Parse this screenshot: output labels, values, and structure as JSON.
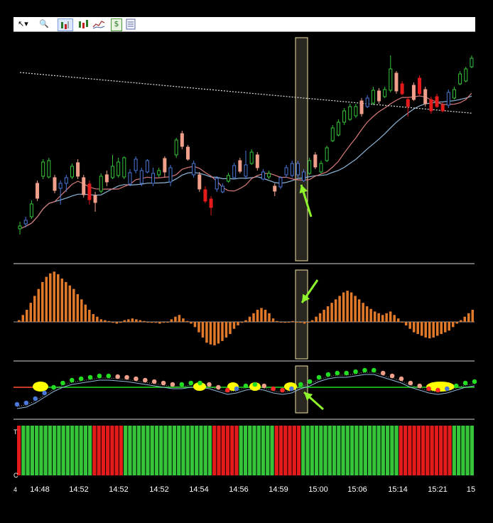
{
  "toolbar": {
    "tools": [
      {
        "name": "cursor-icon",
        "glyph": "↖▾"
      },
      {
        "name": "zoom-icon",
        "glyph": "🔍"
      },
      {
        "name": "bar-chart-icon",
        "glyph": "▮"
      },
      {
        "name": "candlestick-icon",
        "glyph": "▮"
      },
      {
        "name": "line-chart-icon",
        "glyph": "∿"
      },
      {
        "name": "dollar-icon",
        "glyph": "$"
      },
      {
        "name": "properties-icon",
        "glyph": "▤"
      }
    ]
  },
  "colors": {
    "background": "#000000",
    "separator": "#d8d8d8",
    "bull": "#35c43a",
    "bear": "#e51b1b",
    "bull_weak": "#4a78d8",
    "bear_weak": "#f0a08a",
    "histogram": "#e07a2a",
    "highlight_fill": "#2a2620",
    "highlight_edge": "#f2e4a6",
    "arrow": "#8ef32a",
    "ma_fast": "#d87a7a",
    "ma_slow": "#8fb6d8",
    "ma_200": "#e0e0e0",
    "zero_line": "#22e022",
    "signal_red": "#ff2a2a",
    "signal_yellow": "#ffff00",
    "text": "#ffffff"
  },
  "axis": {
    "time_labels": [
      "14:48",
      "14:52",
      "14:52",
      "14:52",
      "14:54",
      "14:56",
      "14:59",
      "15:00",
      "15:06",
      "15:14",
      "15:21",
      "15"
    ],
    "panel_labels": [
      "T",
      "C"
    ],
    "corner_label": "4"
  },
  "chart_data": [
    {
      "type": "candlestick",
      "series": [
        {
          "name": "price",
          "values": [
            [
              "bull",
              318,
              322,
              312,
              330
            ],
            [
              "bull_weak",
              310,
              315,
              305,
              320
            ],
            [
              "bull",
              287,
              305,
              282,
              308
            ],
            [
              "bear_weak",
              258,
              279,
              254,
              283
            ],
            [
              "bull",
              228,
              248,
              224,
              252
            ],
            [
              "bull",
              226,
              249,
              222,
              251
            ],
            [
              "bear_weak",
              250,
              268,
              246,
              272
            ],
            [
              "bull_weak",
              258,
              265,
              254,
              288
            ],
            [
              "bull_weak",
              250,
              258,
              246,
              270
            ],
            [
              "bull",
              234,
              249,
              230,
              252
            ],
            [
              "bear_weak",
              229,
              248,
              224,
              252
            ],
            [
              "bear_weak",
              250,
              274,
              246,
              278
            ],
            [
              "bear",
              259,
              281,
              254,
              288
            ],
            [
              "bear_weak",
              275,
              285,
              270,
              298
            ],
            [
              "bull",
              248,
              269,
              244,
              272
            ],
            [
              "bear_weak",
              246,
              256,
              240,
              262
            ],
            [
              "bull",
              234,
              250,
              218,
              252
            ],
            [
              "bull",
              228,
              247,
              222,
              250
            ],
            [
              "bull",
              222,
              249,
              220,
              252
            ],
            [
              "bull_weak",
              243,
              259,
              238,
              262
            ],
            [
              "bull_weak",
              224,
              240,
              220,
              244
            ],
            [
              "bull_weak",
              240,
              258,
              236,
              262
            ],
            [
              "bull_weak",
              226,
              242,
              224,
              244
            ],
            [
              "bull_weak",
              244,
              258,
              236,
              262
            ],
            [
              "bull",
              240,
              246,
              236,
              250
            ],
            [
              "bear_weak",
              223,
              242,
              220,
              250
            ],
            [
              "bull_weak",
              236,
              256,
              232,
              262
            ],
            [
              "bull",
              197,
              218,
              194,
              222
            ],
            [
              "bear_weak",
              188,
              206,
              184,
              210
            ],
            [
              "bear_weak",
              207,
              224,
              204,
              226
            ],
            [
              "bull_weak",
              230,
              246,
              226,
              250
            ],
            [
              "bear_weak",
              246,
              266,
              242,
              270
            ],
            [
              "bear",
              267,
              283,
              262,
              286
            ],
            [
              "bear",
              280,
              292,
              276,
              303
            ],
            [
              "bull_weak",
              251,
              266,
              248,
              270
            ],
            [
              "bull_weak",
              262,
              270,
              258,
              272
            ],
            [
              "bull",
              247,
              255,
              243,
              257
            ],
            [
              "bull_weak",
              233,
              250,
              229,
              252
            ],
            [
              "bear_weak",
              226,
              241,
              222,
              244
            ],
            [
              "bull_weak",
              232,
              248,
              212,
              252
            ],
            [
              "bull",
              214,
              230,
              210,
              232
            ],
            [
              "bear_weak",
              218,
              236,
              214,
              240
            ],
            [
              "bull_weak",
              242,
              252,
              238,
              254
            ],
            [
              "bull",
              244,
              249,
              240,
              252
            ],
            [
              "bear_weak",
              262,
              269,
              258,
              276
            ],
            [
              "bull_weak",
              250,
              263,
              248,
              266
            ],
            [
              "bull_weak",
              236,
              246,
              232,
              250
            ],
            [
              "bull_weak",
              230,
              247,
              226,
              250
            ],
            [
              "bull_weak",
              230,
              246,
              226,
              250
            ],
            [
              "bull_weak",
              242,
              254,
              238,
              256
            ],
            [
              "bull",
              226,
              244,
              222,
              246
            ],
            [
              "bear_weak",
              218,
              235,
              214,
              238
            ],
            [
              "bull",
              230,
              242,
              226,
              244
            ],
            [
              "bull",
              208,
              226,
              205,
              228
            ],
            [
              "bull",
              180,
              198,
              176,
              200
            ],
            [
              "bull",
              172,
              190,
              168,
              192
            ],
            [
              "bull",
              156,
              172,
              152,
              176
            ],
            [
              "bull",
              150,
              168,
              146,
              170
            ],
            [
              "bull",
              150,
              163,
              146,
              166
            ],
            [
              "bear_weak",
              142,
              160,
              138,
              164
            ],
            [
              "bull_weak",
              138,
              150,
              134,
              152
            ],
            [
              "bull",
              127,
              145,
              122,
              148
            ],
            [
              "bear_weak",
              128,
              142,
              124,
              146
            ],
            [
              "bull",
              126,
              136,
              122,
              138
            ],
            [
              "bull",
              97,
              127,
              78,
              130
            ],
            [
              "bear_weak",
              103,
              128,
              100,
              132
            ],
            [
              "bear",
              118,
              132,
              114,
              134
            ],
            [
              "bear",
              140,
              150,
              136,
              164
            ],
            [
              "bear_weak",
              120,
              140,
              116,
              142
            ],
            [
              "bear",
              110,
              132,
              106,
              134
            ],
            [
              "bear_weak",
              126,
              146,
              122,
              150
            ],
            [
              "bear",
              140,
              156,
              136,
              160
            ],
            [
              "bear",
              136,
              150,
              132,
              152
            ],
            [
              "bear",
              148,
              156,
              144,
              158
            ],
            [
              "bull_weak",
              130,
              148,
              126,
              152
            ],
            [
              "bull",
              126,
              138,
              122,
              140
            ],
            [
              "bull",
              104,
              118,
              100,
              120
            ],
            [
              "bull",
              97,
              114,
              94,
              116
            ],
            [
              "bull",
              82,
              94,
              78,
              96
            ]
          ]
        }
      ],
      "highlight_bar_index": 51
    },
    {
      "type": "bar",
      "values": [
        2,
        8,
        14,
        22,
        30,
        38,
        46,
        52,
        56,
        58,
        55,
        50,
        46,
        42,
        38,
        32,
        26,
        20,
        14,
        9,
        6,
        3,
        2,
        1,
        -1,
        -2,
        -1,
        2,
        3,
        4,
        3,
        2,
        1,
        0,
        -1,
        -1,
        -2,
        -1,
        0,
        3,
        6,
        8,
        4,
        1,
        -2,
        -6,
        -12,
        -18,
        -24,
        -26,
        -27,
        -25,
        -22,
        -18,
        -14,
        -8,
        -4,
        -1,
        2,
        6,
        10,
        14,
        16,
        14,
        10,
        4,
        1,
        0,
        -1,
        0,
        1,
        0,
        -1,
        -2,
        0,
        2,
        6,
        10,
        14,
        18,
        22,
        26,
        30,
        34,
        36,
        34,
        30,
        26,
        22,
        18,
        15,
        12,
        10,
        8,
        10,
        12,
        8,
        4,
        0,
        -4,
        -8,
        -12,
        -14,
        -16,
        -18,
        -19,
        -18,
        -16,
        -14,
        -12,
        -10,
        -6,
        -2,
        2,
        6,
        10,
        14
      ],
      "highlight_bar_index": 62
    },
    {
      "type": "scatter",
      "series": [
        {
          "values": [
            [
              0.0,
              -24
            ],
            [
              0.02,
              -22
            ],
            [
              0.04,
              -16
            ],
            [
              0.06,
              -8
            ],
            [
              0.08,
              0
            ],
            [
              0.1,
              6
            ],
            [
              0.12,
              10
            ],
            [
              0.14,
              12
            ],
            [
              0.16,
              14
            ],
            [
              0.18,
              16
            ],
            [
              0.2,
              16
            ],
            [
              0.22,
              15
            ],
            [
              0.24,
              14
            ],
            [
              0.26,
              12
            ],
            [
              0.28,
              10
            ],
            [
              0.3,
              8
            ],
            [
              0.32,
              6
            ],
            [
              0.34,
              4
            ],
            [
              0.36,
              4
            ],
            [
              0.38,
              6
            ],
            [
              0.4,
              6
            ],
            [
              0.42,
              4
            ],
            [
              0.44,
              0
            ],
            [
              0.46,
              -4
            ],
            [
              0.48,
              -2
            ],
            [
              0.5,
              2
            ],
            [
              0.52,
              4
            ],
            [
              0.54,
              2
            ],
            [
              0.56,
              -2
            ],
            [
              0.58,
              -4
            ],
            [
              0.6,
              -2
            ],
            [
              0.62,
              4
            ],
            [
              0.64,
              8
            ],
            [
              0.66,
              14
            ],
            [
              0.68,
              18
            ],
            [
              0.7,
              20
            ],
            [
              0.72,
              20
            ],
            [
              0.74,
              22
            ],
            [
              0.76,
              24
            ],
            [
              0.78,
              24
            ],
            [
              0.8,
              20
            ],
            [
              0.82,
              16
            ],
            [
              0.84,
              12
            ],
            [
              0.86,
              6
            ],
            [
              0.88,
              2
            ],
            [
              0.9,
              -2
            ],
            [
              0.92,
              -4
            ],
            [
              0.94,
              -2
            ],
            [
              0.96,
              2
            ],
            [
              0.98,
              6
            ],
            [
              1.0,
              8
            ]
          ]
        }
      ]
    },
    {
      "type": "bar",
      "values": [
        "red",
        "green",
        "green",
        "green",
        "green",
        "green",
        "green",
        "green",
        "green",
        "green",
        "green",
        "green",
        "green",
        "green",
        "green",
        "green",
        "green",
        "red",
        "red",
        "red",
        "red",
        "red",
        "red",
        "red",
        "green",
        "green",
        "green",
        "green",
        "green",
        "green",
        "green",
        "green",
        "green",
        "green",
        "green",
        "green",
        "green",
        "green",
        "green",
        "green",
        "green",
        "green",
        "green",
        "green",
        "red",
        "red",
        "red",
        "red",
        "red",
        "red",
        "green",
        "green",
        "green",
        "green",
        "green",
        "green",
        "green",
        "green",
        "red",
        "red",
        "red",
        "red",
        "red",
        "red",
        "green",
        "green",
        "green",
        "green",
        "green",
        "green",
        "green",
        "green",
        "green",
        "green",
        "green",
        "green",
        "green",
        "green",
        "green",
        "green",
        "green",
        "green",
        "green",
        "green",
        "green",
        "green",
        "red",
        "red",
        "red",
        "red",
        "red",
        "red",
        "red",
        "red",
        "red",
        "red",
        "red",
        "red",
        "green",
        "green",
        "green",
        "green",
        "green"
      ]
    }
  ]
}
